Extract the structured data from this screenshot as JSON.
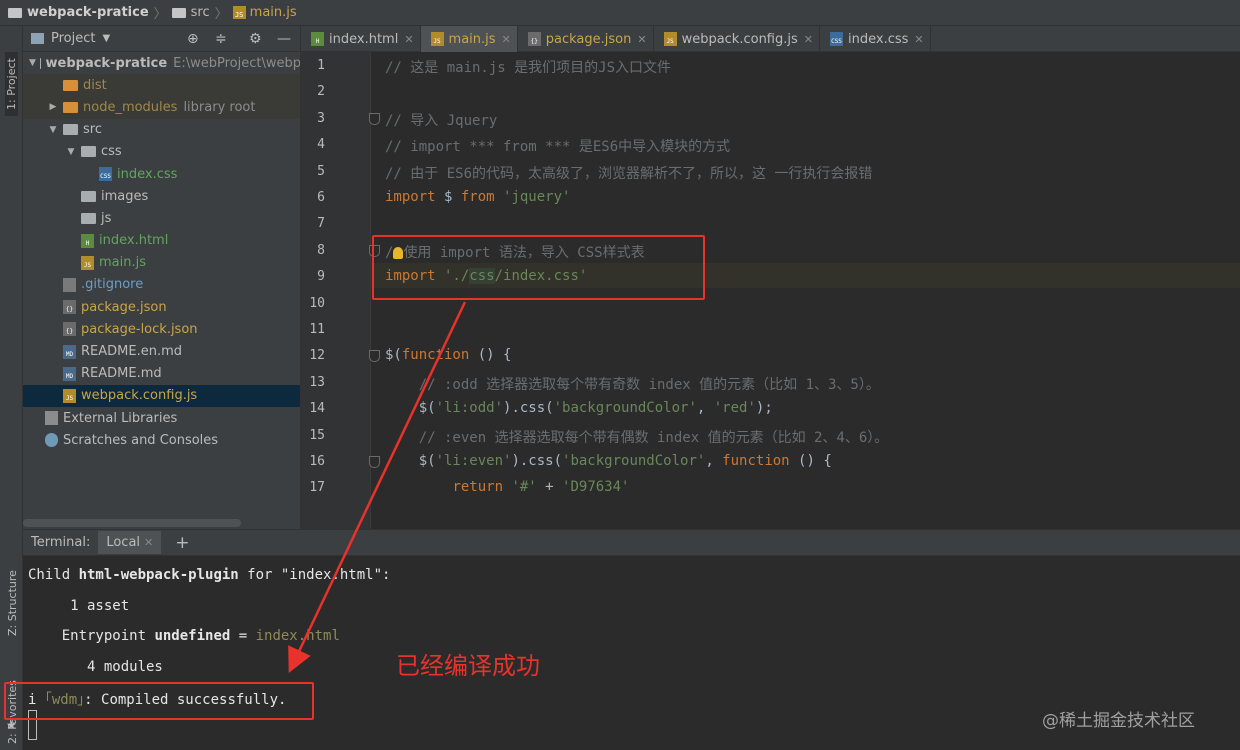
{
  "breadcrumb": {
    "project": "webpack-pratice",
    "folder": "src",
    "file": "main.js"
  },
  "toolstrip": {
    "project": "1: Project",
    "structure": "Z: Structure",
    "favorites": "2: Favorites"
  },
  "project_panel": {
    "title": "Project",
    "tree": [
      {
        "label": "webpack-pratice",
        "extra": "E:\\webProject\\webp",
        "depth": 0,
        "arrow": "down",
        "icon": "folder",
        "style": "bold"
      },
      {
        "label": "dist",
        "depth": 1,
        "arrow": "",
        "icon": "folder-orange",
        "style": "ign"
      },
      {
        "label": "node_modules",
        "extra": "library root",
        "depth": 1,
        "arrow": "right",
        "icon": "folder-orange",
        "style": "ign"
      },
      {
        "label": "src",
        "depth": 1,
        "arrow": "down",
        "icon": "folder",
        "style": ""
      },
      {
        "label": "css",
        "depth": 2,
        "arrow": "down",
        "icon": "folder",
        "style": ""
      },
      {
        "label": "index.css",
        "depth": 3,
        "arrow": "",
        "icon": "css",
        "style": "green"
      },
      {
        "label": "images",
        "depth": 2,
        "arrow": "",
        "icon": "folder",
        "style": ""
      },
      {
        "label": "js",
        "depth": 2,
        "arrow": "",
        "icon": "folder",
        "style": ""
      },
      {
        "label": "index.html",
        "depth": 2,
        "arrow": "",
        "icon": "html",
        "style": "green"
      },
      {
        "label": "main.js",
        "depth": 2,
        "arrow": "",
        "icon": "js",
        "style": "green"
      },
      {
        "label": ".gitignore",
        "depth": 1,
        "arrow": "",
        "icon": "git",
        "style": "blue"
      },
      {
        "label": "package.json",
        "depth": 1,
        "arrow": "",
        "icon": "json",
        "style": "yellow"
      },
      {
        "label": "package-lock.json",
        "depth": 1,
        "arrow": "",
        "icon": "json",
        "style": "yellow"
      },
      {
        "label": "README.en.md",
        "depth": 1,
        "arrow": "",
        "icon": "md",
        "style": ""
      },
      {
        "label": "README.md",
        "depth": 1,
        "arrow": "",
        "icon": "md",
        "style": ""
      },
      {
        "label": "webpack.config.js",
        "depth": 1,
        "arrow": "",
        "icon": "js",
        "style": "yellow-sel"
      },
      {
        "label": "External Libraries",
        "depth": 0,
        "arrow": "",
        "icon": "lib",
        "style": ""
      },
      {
        "label": "Scratches and Consoles",
        "depth": 0,
        "arrow": "",
        "icon": "scr",
        "style": ""
      }
    ]
  },
  "tabs": [
    {
      "label": "index.html",
      "icon": "html",
      "active": false
    },
    {
      "label": "main.js",
      "icon": "js",
      "active": true
    },
    {
      "label": "package.json",
      "icon": "json",
      "active": false
    },
    {
      "label": "webpack.config.js",
      "icon": "js",
      "active": false
    },
    {
      "label": "index.css",
      "icon": "css",
      "active": false
    }
  ],
  "editor": {
    "line_numbers": [
      "1",
      "2",
      "3",
      "4",
      "5",
      "6",
      "7",
      "8",
      "9",
      "10",
      "11",
      "12",
      "13",
      "14",
      "15",
      "16",
      "17"
    ],
    "lines": [
      [
        {
          "t": "// 这是 main.js 是我们项目的JS入口文件",
          "c": "cm"
        }
      ],
      [],
      [
        {
          "t": "// 导入 Jquery",
          "c": "cm"
        }
      ],
      [
        {
          "t": "// import *** from *** 是ES6中导入模块的方式",
          "c": "cm"
        }
      ],
      [
        {
          "t": "// 由于 ES6的代码，太高级了，浏览器解析不了，所以，这 一行执行会报错",
          "c": "cm"
        }
      ],
      [
        {
          "t": "import",
          "c": "kw"
        },
        {
          "t": " $ ",
          "c": ""
        },
        {
          "t": "from",
          "c": "kw"
        },
        {
          "t": " 'jquery'",
          "c": "str"
        }
      ],
      [],
      [
        {
          "t": "/",
          "c": "cm"
        },
        {
          "t": "",
          "c": "bulb"
        },
        {
          "t": "使用 import 语法，导入 CSS样式表",
          "c": "cm"
        }
      ],
      [
        {
          "t": "import",
          "c": "kw"
        },
        {
          "t": " './",
          "c": "str"
        },
        {
          "t": "css",
          "c": "strhl"
        },
        {
          "t": "/index.css'",
          "c": "str"
        }
      ],
      [],
      [],
      [
        {
          "t": "$(",
          "c": ""
        },
        {
          "t": "function",
          "c": "kw"
        },
        {
          "t": " () {",
          "c": ""
        }
      ],
      [
        {
          "t": "    // :odd 选择器选取每个带有奇数 index 值的元素（比如 1、3、5）。",
          "c": "cm"
        }
      ],
      [
        {
          "t": "    $(",
          "c": ""
        },
        {
          "t": "'li:odd'",
          "c": "str"
        },
        {
          "t": ").css(",
          "c": ""
        },
        {
          "t": "'backgroundColor'",
          "c": "str"
        },
        {
          "t": ", ",
          "c": ""
        },
        {
          "t": "'red'",
          "c": "str"
        },
        {
          "t": ");",
          "c": ""
        }
      ],
      [
        {
          "t": "    // :even 选择器选取每个带有偶数 index 值的元素（比如 2、4、6）。",
          "c": "cm"
        }
      ],
      [
        {
          "t": "    $(",
          "c": ""
        },
        {
          "t": "'li:even'",
          "c": "str"
        },
        {
          "t": ").css(",
          "c": ""
        },
        {
          "t": "'backgroundColor'",
          "c": "str"
        },
        {
          "t": ", ",
          "c": ""
        },
        {
          "t": "function",
          "c": "kw"
        },
        {
          "t": " () {",
          "c": ""
        }
      ],
      [
        {
          "t": "        ",
          "c": ""
        },
        {
          "t": "return",
          "c": "kw"
        },
        {
          "t": " '#'",
          "c": "str"
        },
        {
          "t": " + ",
          "c": ""
        },
        {
          "t": "'D97634'",
          "c": "str"
        }
      ]
    ]
  },
  "terminal": {
    "label": "Terminal:",
    "tab": "Local",
    "plus": "+",
    "lines": [
      [
        {
          "t": "Child ",
          "c": ""
        },
        {
          "t": "html-webpack-plugin",
          "c": "b"
        },
        {
          "t": " for \"index.html\":",
          "c": ""
        }
      ],
      [
        {
          "t": "     1 asset",
          "c": ""
        }
      ],
      [
        {
          "t": "    Entrypoint ",
          "c": ""
        },
        {
          "t": "undefined",
          "c": "b"
        },
        {
          "t": " = ",
          "c": ""
        },
        {
          "t": "index.html",
          "c": "dim"
        }
      ],
      [
        {
          "t": "       4 modules",
          "c": ""
        }
      ],
      [
        {
          "t": "i ",
          "c": ""
        },
        {
          "t": "｢wdm｣",
          "c": "dim"
        },
        {
          "t": ": Compiled successfully.",
          "c": ""
        }
      ]
    ]
  },
  "annotation": {
    "text": "已经编译成功",
    "color": "#e8322b"
  },
  "watermark": "@稀土掘金技术社区"
}
